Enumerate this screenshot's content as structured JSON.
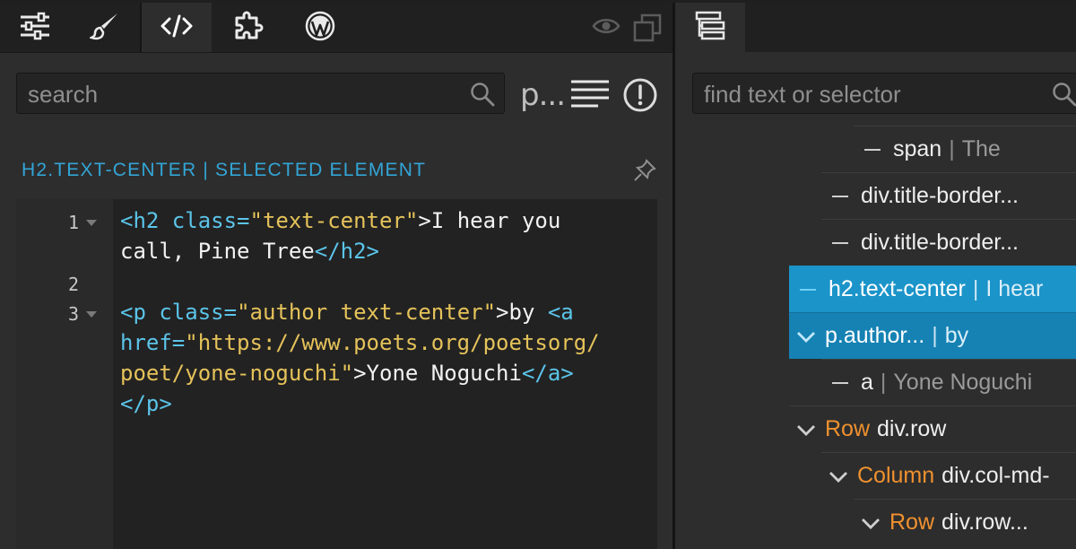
{
  "left_panel": {
    "tabs": [
      {
        "icon": "sliders-icon",
        "active": false
      },
      {
        "icon": "brush-icon",
        "active": false
      },
      {
        "icon": "code-icon",
        "active": true
      },
      {
        "icon": "puzzle-icon",
        "active": false
      },
      {
        "icon": "wordpress-icon",
        "active": false
      }
    ],
    "toolbar_right_icons": [
      "eye-icon",
      "clone-icon"
    ],
    "search": {
      "placeholder": "search",
      "value": ""
    },
    "format_label": "p...",
    "selected_label": "H2.TEXT-CENTER | SELECTED ELEMENT",
    "code": {
      "line_numbers": [
        "1",
        "2",
        "3"
      ],
      "lines": [
        {
          "seg": [
            "<h2 ",
            "class=",
            "\"text-center\"",
            ">I hear you"
          ]
        },
        {
          "seg": [
            "call, Pine Tree",
            "</h2>"
          ]
        },
        {
          "seg": []
        },
        {
          "seg": [
            "<p ",
            "class=",
            "\"author text-center\"",
            ">by ",
            "<a"
          ]
        },
        {
          "seg": [
            "href=",
            "\"https://www.poets.org/poetsorg/"
          ]
        },
        {
          "seg": [
            "poet/yone-noguchi\"",
            ">Yone Noguchi",
            "</a>"
          ]
        },
        {
          "seg": [
            "</p>"
          ]
        }
      ]
    }
  },
  "right_panel": {
    "tab_icon": "tree-icon",
    "search": {
      "placeholder": "find text or selector",
      "value": ""
    },
    "tree": [
      {
        "name": "span",
        "desc": "The",
        "kind": "",
        "toggle": "dash",
        "state": "normal"
      },
      {
        "name": "div.title-border...",
        "desc": "",
        "kind": "",
        "toggle": "dash",
        "state": "normal"
      },
      {
        "name": "div.title-border...",
        "desc": "",
        "kind": "",
        "toggle": "dash",
        "state": "normal"
      },
      {
        "name": "h2.text-center",
        "desc": "I hear",
        "kind": "",
        "toggle": "dash",
        "state": "selected"
      },
      {
        "name": "p.author...",
        "desc": "by",
        "kind": "",
        "toggle": "chevron",
        "state": "highlighted"
      },
      {
        "name": "a",
        "desc": "Yone Noguchi",
        "kind": "",
        "toggle": "dash",
        "state": "normal"
      },
      {
        "name": "div.row",
        "desc": "",
        "kind": "Row",
        "toggle": "chevron",
        "state": "normal"
      },
      {
        "name": "div.col-md-",
        "desc": "",
        "kind": "Column",
        "toggle": "chevron",
        "state": "normal"
      },
      {
        "name": "div.row...",
        "desc": "",
        "kind": "Row",
        "toggle": "chevron",
        "state": "normal"
      }
    ]
  },
  "colors": {
    "accent": "#1b94c9",
    "tag": "#5bc4e8",
    "string": "#e5c25a",
    "kind": "#f0912f"
  }
}
